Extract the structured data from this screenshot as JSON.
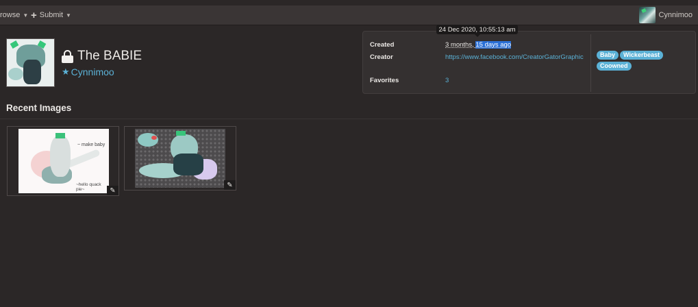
{
  "nav": {
    "browse_label": "rowse",
    "submit_label": "Submit",
    "user_name": "Cynnimoo"
  },
  "tooltip": {
    "text": "24 Dec 2020, 10:55:13 am"
  },
  "character": {
    "title": "The BABIE",
    "owner_name": "Cynnimoo",
    "owner_star": "★",
    "locked": true
  },
  "info": {
    "created_label": "Created",
    "created_value_plain": "3 months, ",
    "created_value_highlight": "15 days ago",
    "creator_label": "Creator",
    "creator_value": "https://www.facebook.com/CreatorGatorGraphic",
    "favorites_label": "Favorites",
    "favorites_value": "3",
    "tags": [
      "Baby",
      "Wickerbeast",
      "Coowned"
    ]
  },
  "recent": {
    "title": "Recent Images",
    "images": [
      {
        "caption_1": "~ make baby",
        "caption_2": "~hello quack pie~"
      },
      {}
    ]
  },
  "colors": {
    "background": "#2b2727",
    "topbar": "#3a3535",
    "accent": "#5bb1d6",
    "selection": "#2a6fd6"
  },
  "icons": {
    "lock": "lock-icon",
    "star": "star-icon",
    "edit": "pencil-icon",
    "plus": "plus-icon",
    "caret": "caret-down-icon"
  }
}
